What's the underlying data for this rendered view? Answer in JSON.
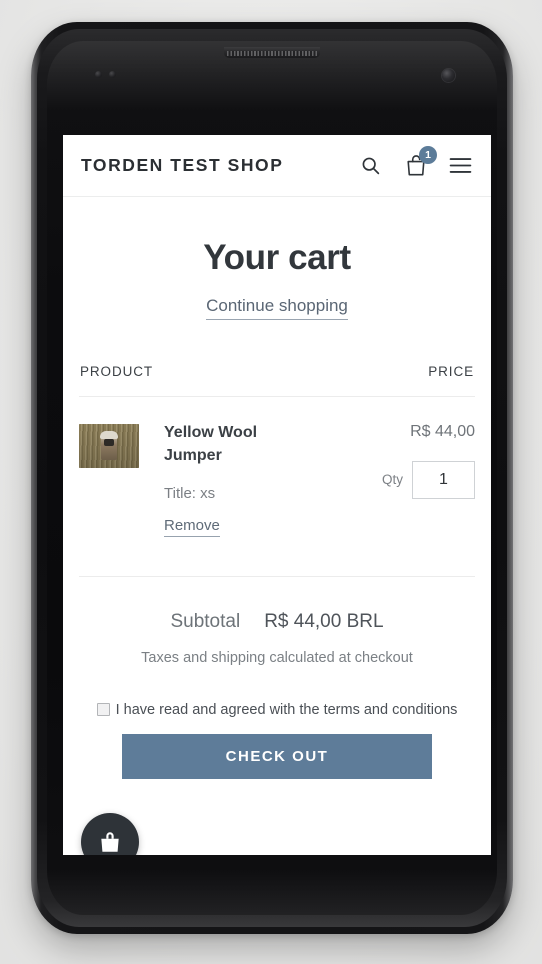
{
  "device": {
    "kind": "smartphone-mockup",
    "earpiece": "speaker-grille",
    "front_camera": "front-camera-lens"
  },
  "header": {
    "shop_name": "TORDEN TEST SHOP",
    "search_icon": "search-icon",
    "cart_icon": "shopping-bag-icon",
    "cart_count": "1",
    "menu_icon": "hamburger-menu-icon",
    "badge_color": "#5c7c99"
  },
  "page": {
    "title": "Your cart",
    "continue_link": "Continue shopping"
  },
  "table": {
    "headers": {
      "product": "PRODUCT",
      "price": "PRICE"
    }
  },
  "items": [
    {
      "thumbnail": "product-photo-person-in-field",
      "name": "Yellow Wool Jumper",
      "variant": "Title: xs",
      "remove_label": "Remove",
      "price": "R$ 44,00",
      "qty_label": "Qty",
      "qty_value": "1"
    }
  ],
  "totals": {
    "subtotal_label": "Subtotal",
    "subtotal_value": "R$ 44,00 BRL",
    "tax_note": "Taxes and shipping calculated at checkout"
  },
  "terms": {
    "checked": false,
    "text": "I have read and agreed with the terms and conditions"
  },
  "checkout": {
    "label": "CHECK OUT",
    "color": "#5e7c99"
  },
  "widget": {
    "chat_icon": "shopping-bag-widget-icon"
  }
}
